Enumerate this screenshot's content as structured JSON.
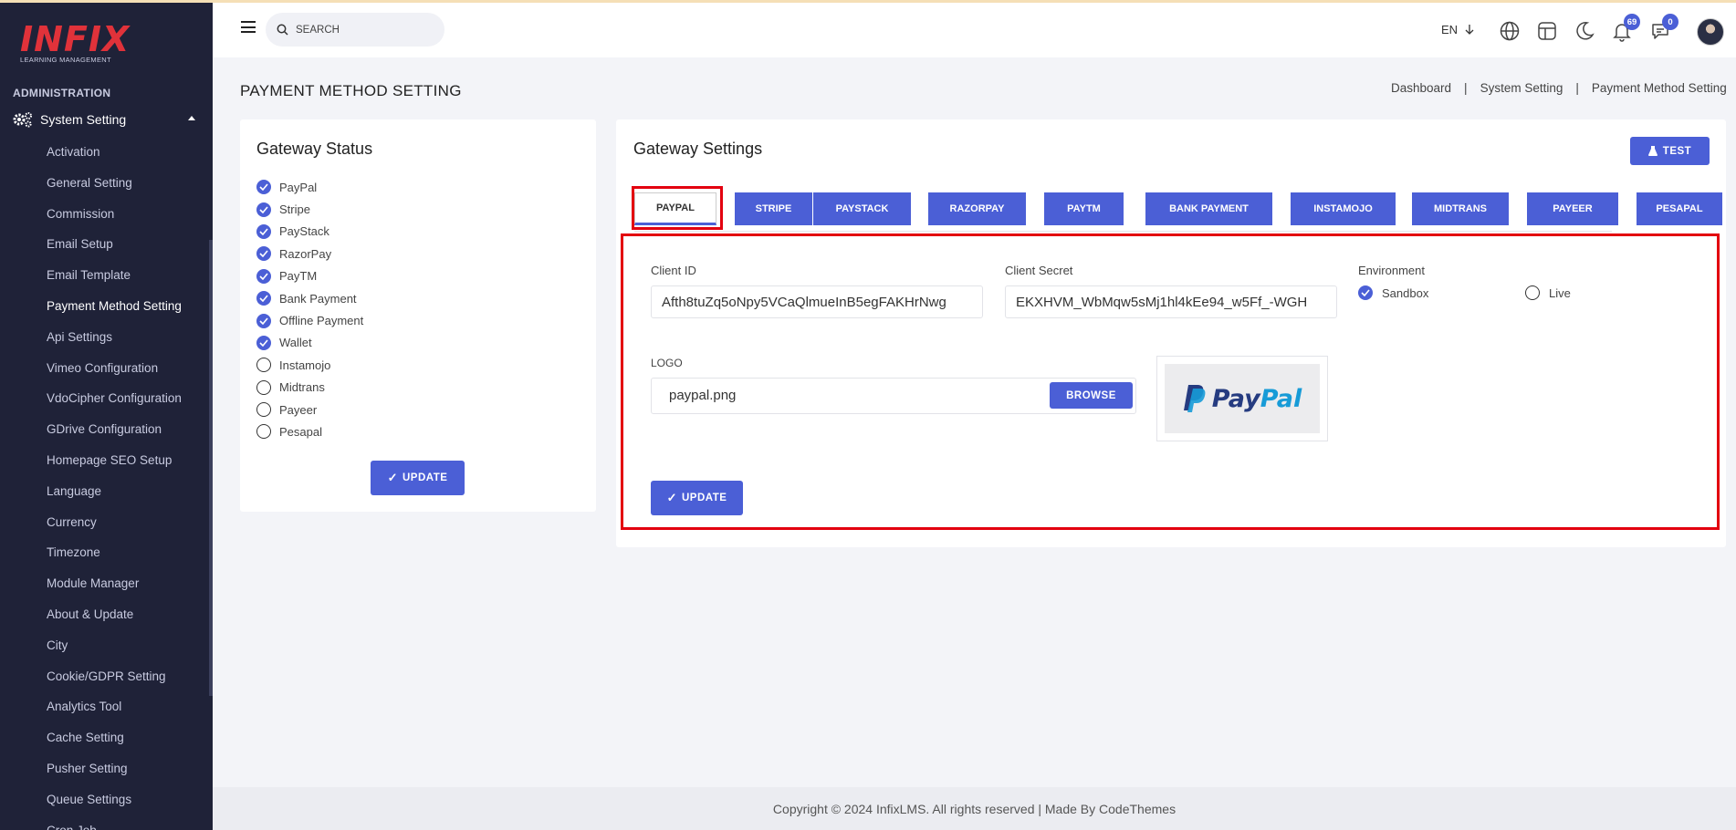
{
  "sidebar": {
    "logo": "INFIX",
    "logo_sub": "LEARNING MANAGEMENT",
    "section": "ADMINISTRATION",
    "group": "System Setting",
    "items": [
      {
        "label": "Activation"
      },
      {
        "label": "General Setting"
      },
      {
        "label": "Commission"
      },
      {
        "label": "Email Setup"
      },
      {
        "label": "Email Template"
      },
      {
        "label": "Payment Method Setting",
        "active": true
      },
      {
        "label": "Api Settings"
      },
      {
        "label": "Vimeo Configuration"
      },
      {
        "label": "VdoCipher Configuration"
      },
      {
        "label": "GDrive Configuration"
      },
      {
        "label": "Homepage SEO Setup"
      },
      {
        "label": "Language"
      },
      {
        "label": "Currency"
      },
      {
        "label": "Timezone"
      },
      {
        "label": "Module Manager"
      },
      {
        "label": "About & Update"
      },
      {
        "label": "City"
      },
      {
        "label": "Cookie/GDPR Setting"
      },
      {
        "label": "Analytics Tool"
      },
      {
        "label": "Cache Setting"
      },
      {
        "label": "Pusher Setting"
      },
      {
        "label": "Queue Settings"
      },
      {
        "label": "Cron Job"
      }
    ]
  },
  "header": {
    "search_placeholder": "SEARCH",
    "language": "EN",
    "notifications_count": "69",
    "messages_count": "0"
  },
  "page": {
    "title": "PAYMENT METHOD SETTING",
    "breadcrumb": [
      "Dashboard",
      "|",
      "System Setting",
      "|",
      "Payment Method Setting"
    ]
  },
  "gateway_status": {
    "title": "Gateway Status",
    "gateways": [
      {
        "name": "PayPal",
        "enabled": true
      },
      {
        "name": "Stripe",
        "enabled": true
      },
      {
        "name": "PayStack",
        "enabled": true
      },
      {
        "name": "RazorPay",
        "enabled": true
      },
      {
        "name": "PayTM",
        "enabled": true
      },
      {
        "name": "Bank Payment",
        "enabled": true
      },
      {
        "name": "Offline Payment",
        "enabled": true
      },
      {
        "name": "Wallet",
        "enabled": true
      },
      {
        "name": "Instamojo",
        "enabled": false
      },
      {
        "name": "Midtrans",
        "enabled": false
      },
      {
        "name": "Payeer",
        "enabled": false
      },
      {
        "name": "Pesapal",
        "enabled": false
      }
    ],
    "update_label": "UPDATE"
  },
  "gateway_settings": {
    "title": "Gateway Settings",
    "test_label": "TEST",
    "tabs": [
      "PAYPAL",
      "STRIPE",
      "PAYSTACK",
      "RAZORPAY",
      "PAYTM",
      "BANK PAYMENT",
      "INSTAMOJO",
      "MIDTRANS",
      "PAYEER",
      "PESAPAL"
    ],
    "active_tab": "PAYPAL",
    "client_id_label": "Client ID",
    "client_id_value": "Afth8tuZq5oNpy5VCaQlmueInB5egFAKHrNwg",
    "client_secret_label": "Client Secret",
    "client_secret_value": "EKXHVM_WbMqw5sMj1hl4kEe94_w5Ff_-WGH",
    "environment_label": "Environment",
    "env_sandbox": "Sandbox",
    "env_live": "Live",
    "env_selected": "Sandbox",
    "logo_label": "LOGO",
    "logo_file": "paypal.png",
    "browse_label": "BROWSE",
    "logo_pay": "Pay",
    "logo_pal": "Pal",
    "update_label": "UPDATE"
  },
  "footer": {
    "text": "Copyright © 2024 InfixLMS. All rights reserved | Made By CodeThemes"
  },
  "colors": {
    "sidebar_bg": "#1f2238",
    "primary": "#4b5fd6",
    "highlight_red": "#e3000f",
    "page_bg": "#f3f4f8"
  }
}
